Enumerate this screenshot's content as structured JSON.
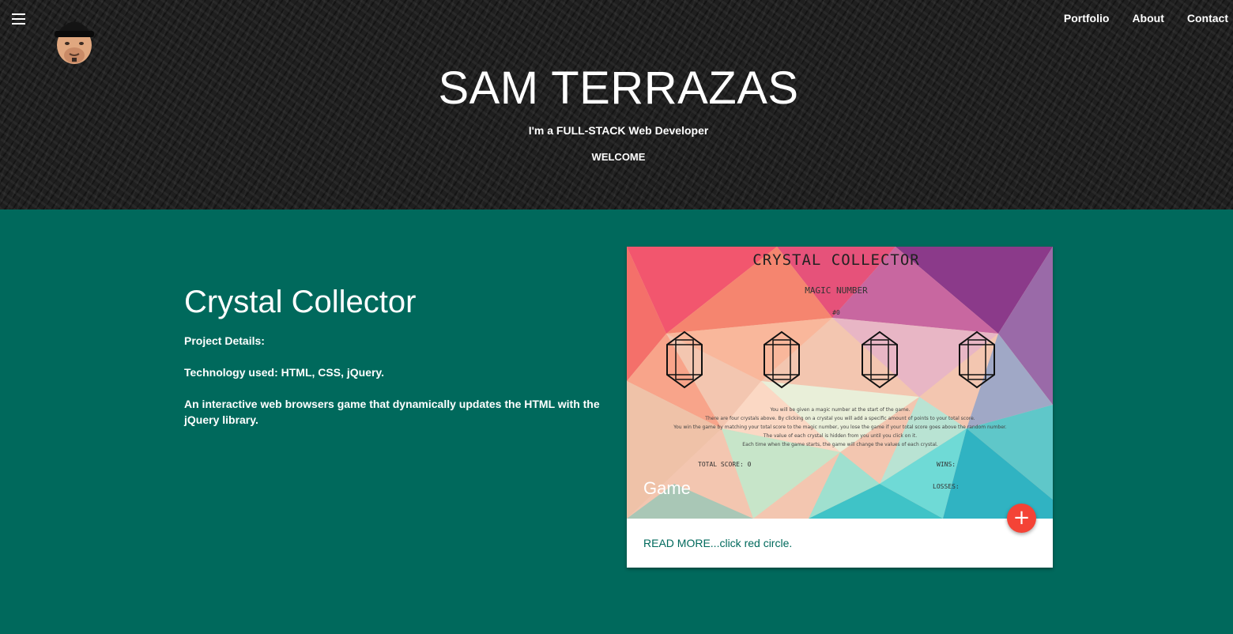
{
  "nav": {
    "items": [
      "Portfolio",
      "About",
      "Contact"
    ]
  },
  "hero": {
    "title": "SAM TERRAZAS",
    "subtitle": "I'm a FULL-STACK Web Developer",
    "welcome": "WELCOME"
  },
  "project": {
    "title": "Crystal Collector",
    "details_label": "Project Details:",
    "technology": "Technology used: HTML, CSS, jQuery.",
    "description": "An interactive web browsers game that dynamically updates the HTML with the jQuery library."
  },
  "card": {
    "label": "Game",
    "action": "READ MORE...click red circle.",
    "fab_symbol": "+",
    "accent": "#f44336",
    "screenshot": {
      "title": "CRYSTAL COLLECTOR",
      "magic_label": "MAGIC NUMBER",
      "magic_value": "#0",
      "instructions": [
        "You will be given a magic number at the start of the game.",
        "There are four crystals above. By clicking on a crystal you will add a specific amount of points to your total score.",
        "You win the game by matching your total score to the magic number, you lose the game if your total score goes above the random number.",
        "The value of each crystal is hidden from you until you click on it.",
        "Each time when the game starts, the game will change the values of each crystal."
      ],
      "total_score": "TOTAL SCORE: 0",
      "wins": "WINS:",
      "losses": "LOSSES:"
    }
  },
  "colors": {
    "header_bg": "#1f1f1f",
    "page_bg": "#00695c",
    "link": "#00695c"
  }
}
